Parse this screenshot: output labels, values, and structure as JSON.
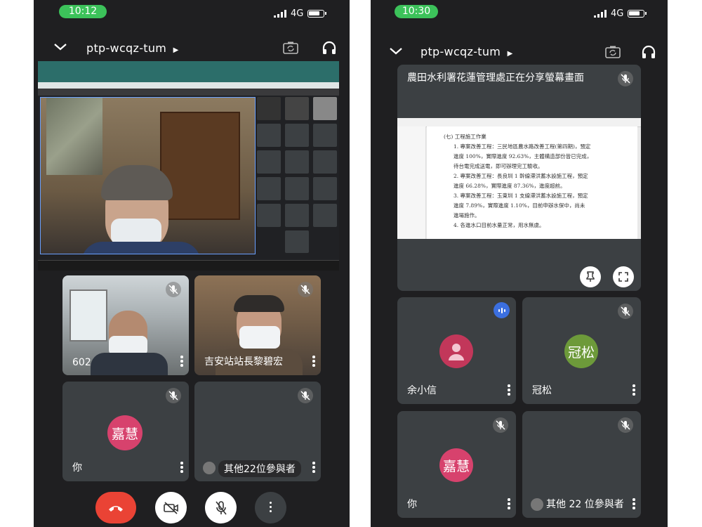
{
  "left": {
    "time": "10:12",
    "network": "4G",
    "meeting_code": "ptp-wcqz-tum",
    "tiles": [
      {
        "name": "602"
      },
      {
        "name": "吉安站站長黎碧宏"
      },
      {
        "name": "你",
        "initials": "嘉慧"
      },
      {
        "name": "其他22位參與者"
      }
    ]
  },
  "right": {
    "time": "10:30",
    "network": "4G",
    "meeting_code": "ptp-wcqz-tum",
    "presenting_label": "農田水利署花蓮管理處正在分享螢幕畫面",
    "document": {
      "heading": "(七) 工程施工作業",
      "items": [
        "1.  專案改善工程：三民地區農水路改善工程(第四期)，預定",
        "    進度 100%，實際進度 92.63%，主體構造部份皆已完成，",
        "    待台電完成送電，即可辦理完工驗收。",
        "2.  專案改善工程：長良圳 1 幹線滯洪蓄水設施工程，預定",
        "    進度 66.28%，實際進度 87.36%，進度超前。",
        "3.  專案改善工程：玉東圳 1 支線滯洪蓄水設施工程，預定",
        "    進度 7.89%，實際進度 1.10%，目前申辦水保中，尚未",
        "    進場施作。",
        "4.  各進水口目前水量正常，用水無虞。"
      ]
    },
    "tiles": [
      {
        "name": "余小信"
      },
      {
        "name": "冠松",
        "initials": "冠松"
      },
      {
        "name": "你",
        "initials": "嘉慧"
      },
      {
        "name": "其他 22 位參與者"
      }
    ]
  },
  "colors": {
    "time_pill": "#3cc25a",
    "end_call": "#ea4335",
    "avatar_pink": "#d7426d",
    "avatar_green": "#6d9a3a",
    "avatar_crimson": "#c2375a",
    "speaking_blue": "#3b6fe0"
  },
  "icons": [
    "chevron-down-icon",
    "camera-switch-icon",
    "headphones-icon",
    "mic-off-icon",
    "more-vert-icon",
    "pin-icon",
    "fullscreen-icon",
    "phone-hangup-icon",
    "video-off-icon",
    "person-icon",
    "speaking-icon"
  ]
}
